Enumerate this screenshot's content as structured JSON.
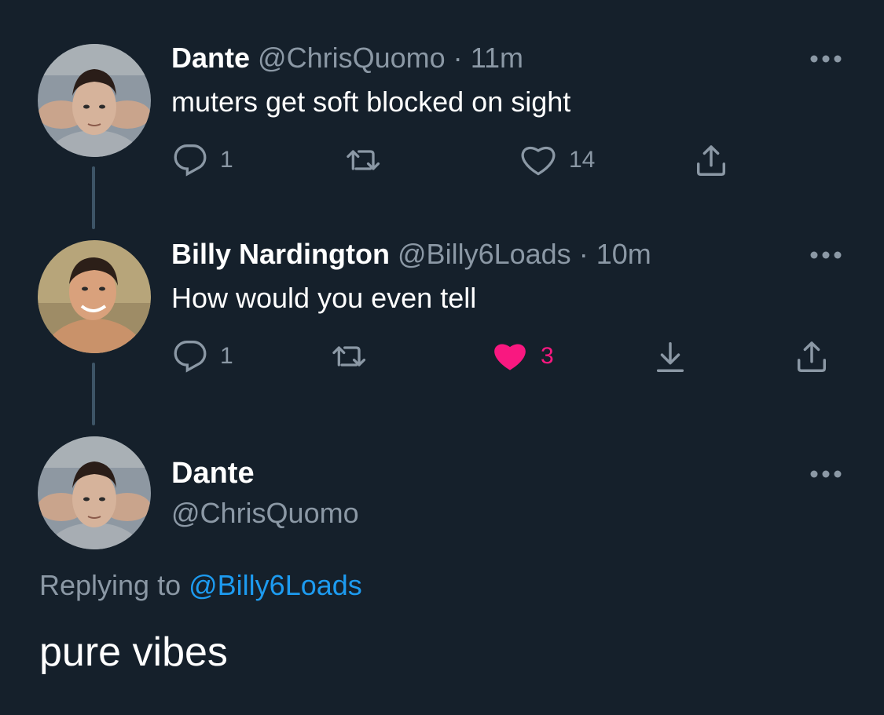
{
  "tweets": [
    {
      "display_name": "Dante",
      "handle": "@ChrisQuomo",
      "separator": "·",
      "time": "11m",
      "text": "muters get soft blocked on sight",
      "reply_count": "1",
      "like_count": "14",
      "liked": false
    },
    {
      "display_name": "Billy Nardington",
      "handle": "@Billy6Loads",
      "separator": "·",
      "time": "10m",
      "text": "How would you even tell",
      "reply_count": "1",
      "like_count": "3",
      "liked": true
    }
  ],
  "main_tweet": {
    "display_name": "Dante",
    "handle": "@ChrisQuomo",
    "replying_prefix": "Replying to",
    "replying_to": "@Billy6Loads",
    "text": "pure vibes"
  },
  "colors": {
    "background": "#15202b",
    "muted": "#8b98a5",
    "link": "#1d9bf0",
    "like": "#f91880",
    "thread_line": "#3d5466"
  },
  "icons": [
    "reply-icon",
    "retweet-icon",
    "like-icon",
    "share-icon",
    "download-icon",
    "more-icon"
  ]
}
